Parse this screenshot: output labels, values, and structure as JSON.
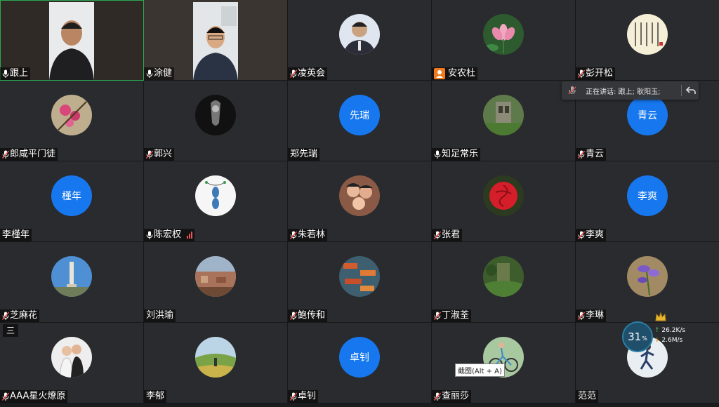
{
  "participants": [
    {
      "name": "跟上",
      "mic": "on",
      "media": "video-1"
    },
    {
      "name": "涂健",
      "mic": "on",
      "media": "video-2"
    },
    {
      "name": "凌英会",
      "mic": "muted",
      "media": "photo-man"
    },
    {
      "name": "安农杜",
      "mic": "person",
      "media": "photo-lotus"
    },
    {
      "name": "彭开松",
      "mic": "muted",
      "media": "photo-calligraphy"
    },
    {
      "name": "郎咸平门徒",
      "mic": "muted",
      "media": "photo-flowers"
    },
    {
      "name": "郭兴",
      "mic": "muted",
      "media": "photo-bw"
    },
    {
      "name": "郑先瑞",
      "mic": "none",
      "media": "text",
      "avatar_text": "先瑞"
    },
    {
      "name": "知足常乐",
      "mic": "on",
      "media": "photo-ruins"
    },
    {
      "name": "青云",
      "mic": "muted",
      "media": "text",
      "avatar_text": "青云"
    },
    {
      "name": "李槿年",
      "mic": "none",
      "media": "text",
      "avatar_text": "槿年"
    },
    {
      "name": "陈宏权",
      "mic": "on",
      "media": "photo-fish",
      "signal": true
    },
    {
      "name": "朱若林",
      "mic": "muted",
      "media": "photo-family"
    },
    {
      "name": "张君",
      "mic": "muted",
      "media": "photo-rose"
    },
    {
      "name": "李爽",
      "mic": "muted",
      "media": "text",
      "avatar_text": "李爽"
    },
    {
      "name": "芝麻花",
      "mic": "muted",
      "media": "photo-tower"
    },
    {
      "name": "刘洪瑜",
      "mic": "none",
      "media": "photo-town"
    },
    {
      "name": "鲍传和",
      "mic": "muted",
      "media": "photo-boats"
    },
    {
      "name": "丁淑荃",
      "mic": "muted",
      "media": "photo-garden"
    },
    {
      "name": "李琳",
      "mic": "muted",
      "media": "photo-iris"
    },
    {
      "name": "AAA星火燎原",
      "mic": "muted",
      "media": "photo-couple"
    },
    {
      "name": "李郁",
      "mic": "none",
      "media": "photo-field"
    },
    {
      "name": "卓钊",
      "mic": "muted",
      "media": "text",
      "avatar_text": "卓钊"
    },
    {
      "name": "查丽莎",
      "mic": "muted",
      "media": "photo-bike"
    },
    {
      "name": "范范",
      "mic": "none",
      "media": "photo-runner"
    }
  ],
  "speaking_popup": {
    "text": "正在讲话: 跟上; 耿阳玉;"
  },
  "tooltip": {
    "text": "截图(Alt + A)"
  },
  "network": {
    "percent": "31",
    "percent_unit": "%",
    "upload": "26.2K/s",
    "download": "2.6M/s"
  },
  "menu_button": {
    "label": "三"
  },
  "colors": {
    "tile_bg": "#2a2b2e",
    "avatar_blue": "#1677ee",
    "active_border": "#2aa851",
    "mic_muted": "#e05050",
    "mic_on": "#ffffff"
  }
}
